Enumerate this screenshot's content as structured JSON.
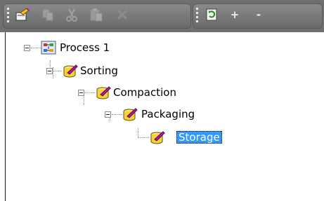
{
  "toolbar": {
    "buttons": [
      {
        "icon": "new-node-icon",
        "enabled": true
      },
      {
        "icon": "copy-icon",
        "enabled": false
      },
      {
        "icon": "cut-icon",
        "enabled": false
      },
      {
        "icon": "paste-icon",
        "enabled": false
      },
      {
        "icon": "delete-icon",
        "enabled": false
      },
      {
        "icon": "refresh-icon",
        "enabled": true
      }
    ],
    "expand_label": "+",
    "collapse_label": "-"
  },
  "tree": {
    "root": {
      "label": "Process 1",
      "icon": "process-icon"
    },
    "nodes": [
      {
        "label": "Sorting",
        "icon": "step-icon"
      },
      {
        "label": "Compaction",
        "icon": "step-icon"
      },
      {
        "label": "Packaging",
        "icon": "step-icon"
      },
      {
        "label": "Storage",
        "icon": "step-icon",
        "selected": true
      }
    ]
  },
  "colors": {
    "toolbar_bg": "#6f6f6f",
    "selection": "#3399ff",
    "step_icon_yellow": "#f2d43a",
    "step_icon_magenta": "#c0189a"
  }
}
